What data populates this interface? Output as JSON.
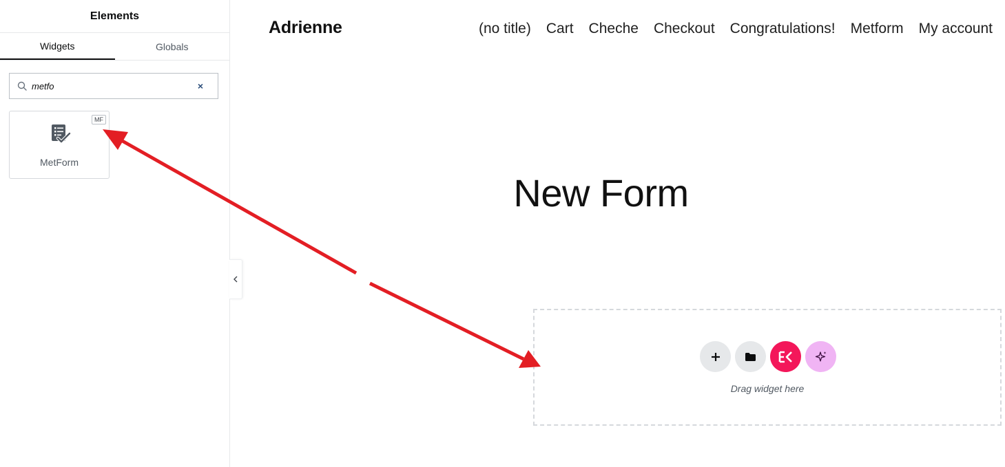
{
  "panel": {
    "title": "Elements",
    "tabs": [
      {
        "label": "Widgets",
        "active": true
      },
      {
        "label": "Globals",
        "active": false
      }
    ],
    "search": {
      "value": "metfo",
      "placeholder": "Search Widget..."
    },
    "widgets": [
      {
        "label": "MetForm",
        "badge": "MF",
        "icon": "form-checklist-icon"
      }
    ]
  },
  "site": {
    "title": "Adrienne",
    "nav": [
      "(no title)",
      "Cart",
      "Cheche",
      "Checkout",
      "Congratulations!",
      "Metform",
      "My account"
    ]
  },
  "page": {
    "heading": "New Form"
  },
  "drop_zone": {
    "text": "Drag widget here",
    "buttons": [
      "add-section",
      "add-template",
      "elementskit",
      "ai-assistant"
    ]
  },
  "colors": {
    "accent_pink": "#f3175a",
    "ai_pink": "#f0b4f4",
    "arrow_red": "#e31e24"
  }
}
